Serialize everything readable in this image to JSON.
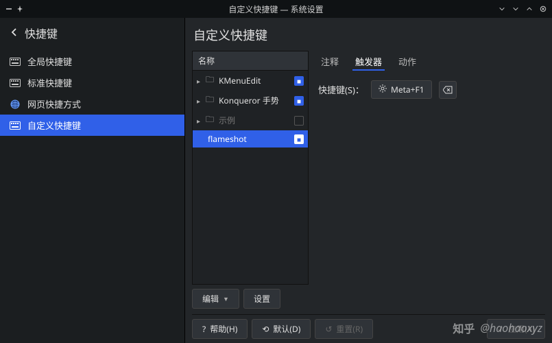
{
  "titlebar": {
    "title": "自定义快捷键 — 系统设置"
  },
  "sidebar": {
    "header": "快捷键",
    "items": [
      {
        "label": "全局快捷键",
        "icon": "keyboard"
      },
      {
        "label": "标准快捷键",
        "icon": "keyboard"
      },
      {
        "label": "网页快捷方式",
        "icon": "web"
      },
      {
        "label": "自定义快捷键",
        "icon": "keyboard",
        "active": true
      }
    ]
  },
  "page": {
    "title": "自定义快捷键",
    "tree": {
      "header": "名称",
      "items": [
        {
          "label": "KMenuEdit",
          "checked": true,
          "folder": true
        },
        {
          "label": "Konqueror 手势",
          "checked": true,
          "folder": true
        },
        {
          "label": "示例",
          "checked": false,
          "folder": true,
          "dim": true
        },
        {
          "label": "flameshot",
          "checked": true,
          "folder": false,
          "selected": true,
          "level": 1
        }
      ],
      "edit_label": "编辑",
      "settings_label": "设置"
    },
    "tabs": [
      {
        "label": "注释"
      },
      {
        "label": "触发器",
        "active": true
      },
      {
        "label": "动作"
      }
    ],
    "trigger": {
      "field_label": "快捷键(S)：",
      "shortcut": "Meta+F1"
    },
    "buttons": {
      "help": "帮助(H)",
      "defaults": "默认(D)",
      "reset": "重置(R)",
      "apply": "应用(A)"
    }
  },
  "watermark": {
    "logo": "知乎",
    "text": "@haohaoxyz"
  }
}
